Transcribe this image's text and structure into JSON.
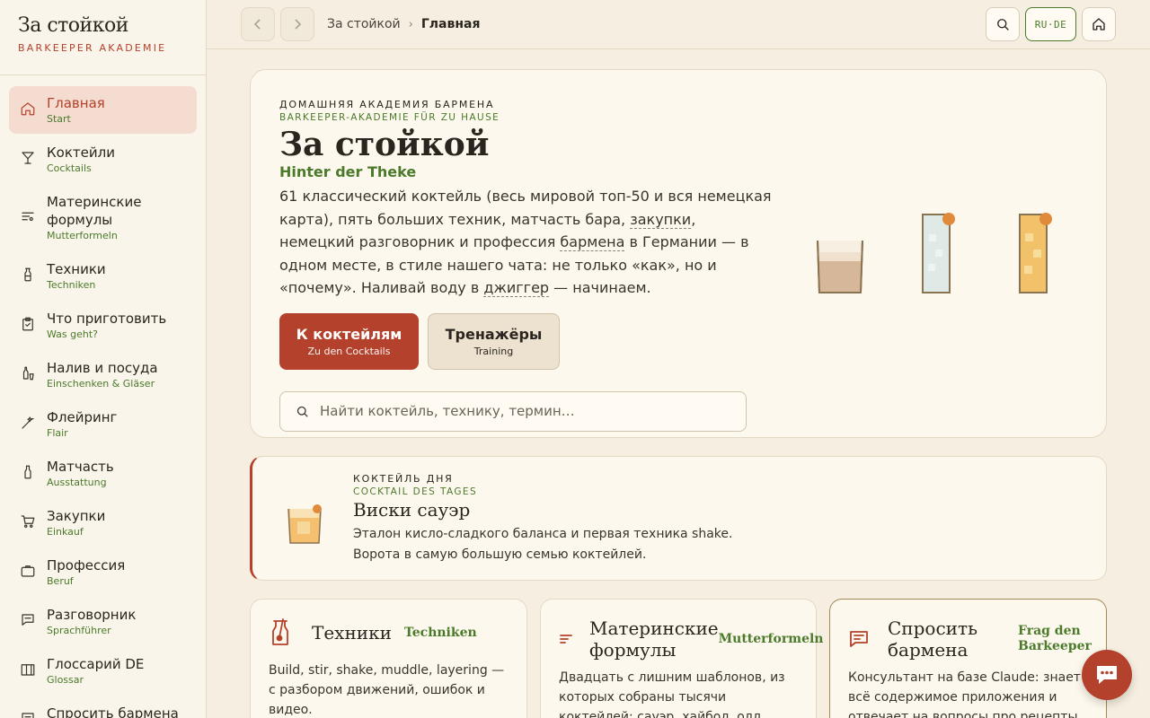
{
  "brand": {
    "title": "За стойкой",
    "subtitle": "BARKEEPER AKADEMIE"
  },
  "sidebar": {
    "items": [
      {
        "label": "Главная",
        "sub": "Start",
        "icon": "home-icon",
        "active": true
      },
      {
        "label": "Коктейли",
        "sub": "Cocktails",
        "icon": "cocktail-glass-icon"
      },
      {
        "label": "Материнские формулы",
        "sub": "Mutterformeln",
        "icon": "formula-icon"
      },
      {
        "label": "Техники",
        "sub": "Techniken",
        "icon": "shaker-icon"
      },
      {
        "label": "Что приготовить",
        "sub": "Was geht?",
        "icon": "clipboard-check-icon"
      },
      {
        "label": "Налив и посуда",
        "sub": "Einschenken & Gläser",
        "icon": "bottle-glass-icon"
      },
      {
        "label": "Флейринг",
        "sub": "Flair",
        "icon": "flair-icon"
      },
      {
        "label": "Матчасть",
        "sub": "Ausstattung",
        "icon": "bottle-icon"
      },
      {
        "label": "Закупки",
        "sub": "Einkauf",
        "icon": "cart-icon"
      },
      {
        "label": "Профессия",
        "sub": "Beruf",
        "icon": "briefcase-icon"
      },
      {
        "label": "Разговорник",
        "sub": "Sprachführer",
        "icon": "chat-icon"
      },
      {
        "label": "Глоссарий DE",
        "sub": "Glossar",
        "icon": "book-icon"
      },
      {
        "label": "Спросить бармена",
        "sub": "",
        "icon": "message-icon"
      }
    ]
  },
  "topbar": {
    "breadcrumb": {
      "parent": "За стойкой",
      "separator": "›",
      "current": "Главная"
    },
    "lang_label": "RU·DE"
  },
  "hero": {
    "eyebrow": "ДОМАШНЯЯ АКАДЕМИЯ БАРМЕНА",
    "eyebrow_de": "BARKEEPER-AKADEMIE FÜR ZU HAUSE",
    "title": "За стойкой",
    "title_de": "Hinter der Theke",
    "desc": {
      "p1": "61 классический коктейль (весь мировой топ-50 и вся немецкая карта), пять больших техник, матчасть бара, ",
      "l1": "закупки",
      "p2": ", немецкий разговорник и профессия ",
      "l2": "бармена",
      "p3": " в Германии — в одном месте, в стиле нашего чата: не только «как», но и «почему». Наливай воду в ",
      "l3": "джиггер",
      "p4": " — начинаем."
    },
    "primary_btn": {
      "label": "К коктейлям",
      "sub": "Zu den Cocktails"
    },
    "secondary_btn": {
      "label": "Тренажёры",
      "sub": "Training"
    },
    "search_placeholder": "Найти коктейль, технику, термин…"
  },
  "cotd": {
    "eyebrow": "КОКТЕЙЛЬ ДНЯ",
    "eyebrow_de": "COCKTAIL DES TAGES",
    "title": "Виски сауэр",
    "desc": "Эталон кисло-сладкого баланса и первая техника shake. Ворота в самую большую семью коктейлей."
  },
  "cards": [
    {
      "title": "Техники",
      "title_de": "Techniken",
      "desc": "Build, stir, shake, muddle, layering — с разбором движений, ошибок и видео.",
      "icon": "shaker-icon"
    },
    {
      "title": "Материнские формулы",
      "title_de": "Mutterformeln",
      "desc": "Двадцать с лишним шаблонов, из которых собраны тысячи коктейлей: сауэр, хайбол, олд фэшен, Негрони,",
      "icon": "formula-icon"
    },
    {
      "title": "Спросить бармена",
      "title_de": "Frag den Barkeeper",
      "desc": "Консультант на базе Claude: знает всё содержимое приложения и отвечает на вопросы про рецепты, технику, закупки",
      "icon": "message-icon"
    }
  ],
  "colors": {
    "accent": "#b4412b",
    "green": "#4a7a2a",
    "background": "#f6efe1",
    "card": "#fdf8ee"
  }
}
